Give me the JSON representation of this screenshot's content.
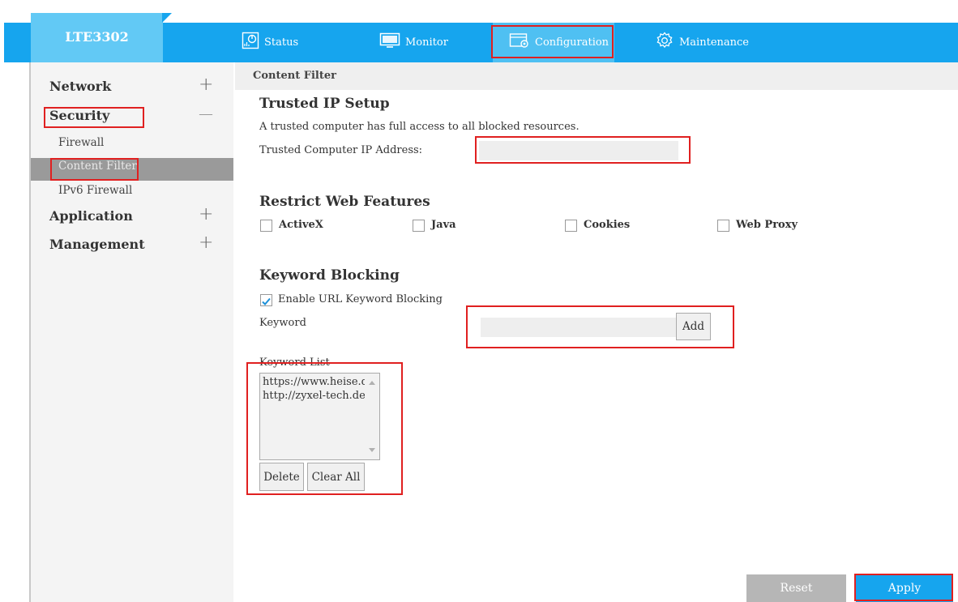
{
  "brand": "LTE3302",
  "nav": {
    "status": "Status",
    "monitor": "Monitor",
    "configuration": "Configuration",
    "maintenance": "Maintenance"
  },
  "sidebar": {
    "network": "Network",
    "security": "Security",
    "firewall": "Firewall",
    "content_filter": "Content Filter",
    "ipv6_firewall": "IPv6 Firewall",
    "application": "Application",
    "management": "Management",
    "plus": "+",
    "minus": "—"
  },
  "breadcrumb": "Content Filter",
  "trusted": {
    "title": "Trusted IP Setup",
    "description": "A trusted computer has full access to all blocked resources.",
    "ip_label": "Trusted Computer IP Address:",
    "ip_value": ""
  },
  "restrict": {
    "title": "Restrict Web Features",
    "activex": "ActiveX",
    "java": "Java",
    "cookies": "Cookies",
    "web_proxy": "Web Proxy"
  },
  "keyword": {
    "title": "Keyword Blocking",
    "enable_label": "Enable URL Keyword Blocking",
    "enable_checked": true,
    "keyword_label": "Keyword",
    "keyword_value": "",
    "add_label": "Add",
    "list_label": "Keyword List",
    "list_items": [
      "https://www.heise.de/",
      "http://zyxel-tech.de/"
    ],
    "delete_label": "Delete",
    "clear_all_label": "Clear All"
  },
  "footer": {
    "reset": "Reset",
    "apply": "Apply"
  }
}
